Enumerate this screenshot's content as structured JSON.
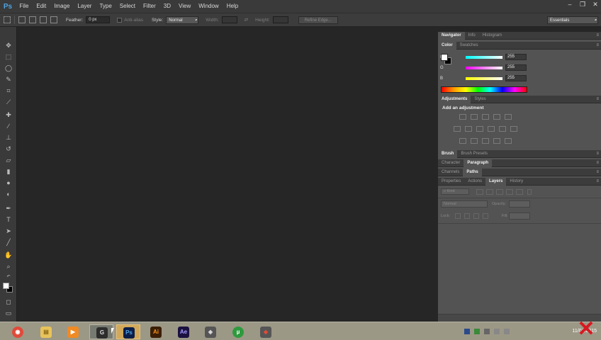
{
  "app": {
    "logo": "Ps"
  },
  "menu": [
    "File",
    "Edit",
    "Image",
    "Layer",
    "Type",
    "Select",
    "Filter",
    "3D",
    "View",
    "Window",
    "Help"
  ],
  "options": {
    "feather_label": "Feather:",
    "feather_value": "0 px",
    "antialias_label": "Anti-alias",
    "style_label": "Style:",
    "style_value": "Normal",
    "width_label": "Width:",
    "height_label": "Height:",
    "refine_edge": "Refine Edge...",
    "workspace": "Essentials"
  },
  "panels": {
    "nav_tabs": [
      "Navigator",
      "Info",
      "Histogram"
    ],
    "color_tabs": [
      "Color",
      "Swatches"
    ],
    "rgb": [
      {
        "letter": "R",
        "value": "255"
      },
      {
        "letter": "G",
        "value": "255"
      },
      {
        "letter": "B",
        "value": "255"
      }
    ],
    "adj_tabs": [
      "Adjustments",
      "Styles"
    ],
    "add_adjustment": "Add an adjustment",
    "brush_tabs": [
      "Brush",
      "Brush Presets"
    ],
    "char_tabs": [
      "Character",
      "Paragraph"
    ],
    "channel_tabs": [
      "Channels",
      "Paths"
    ],
    "layer_tabs": [
      "Properties",
      "Actions",
      "Layers",
      "History"
    ],
    "kind_label": "Kind",
    "blend_mode": "Normal",
    "opacity_label": "Opacity:",
    "lock_label": "Lock:",
    "fill_label": "Fill:"
  },
  "taskbar": {
    "apps": [
      {
        "name": "chrome",
        "glyph": "◉",
        "color": "#e04a3a"
      },
      {
        "name": "explorer",
        "glyph": "▤",
        "color": "#e8c35a"
      },
      {
        "name": "media-player",
        "glyph": "▶",
        "color": "#f08a24"
      },
      {
        "name": "app-g",
        "glyph": "G",
        "color": "#2d2d2d"
      },
      {
        "name": "photoshop",
        "glyph": "Ps",
        "color": "#0b1e4a"
      },
      {
        "name": "illustrator",
        "glyph": "Ai",
        "color": "#3b1e05"
      },
      {
        "name": "after-effects",
        "glyph": "Ae",
        "color": "#1b1240"
      },
      {
        "name": "app-8",
        "glyph": "◈",
        "color": "#555555"
      },
      {
        "name": "utorrent",
        "glyph": "µ",
        "color": "#2e9a3e"
      },
      {
        "name": "app-10",
        "glyph": "◆",
        "color": "#555555"
      }
    ],
    "clock": "11/01/2015"
  }
}
